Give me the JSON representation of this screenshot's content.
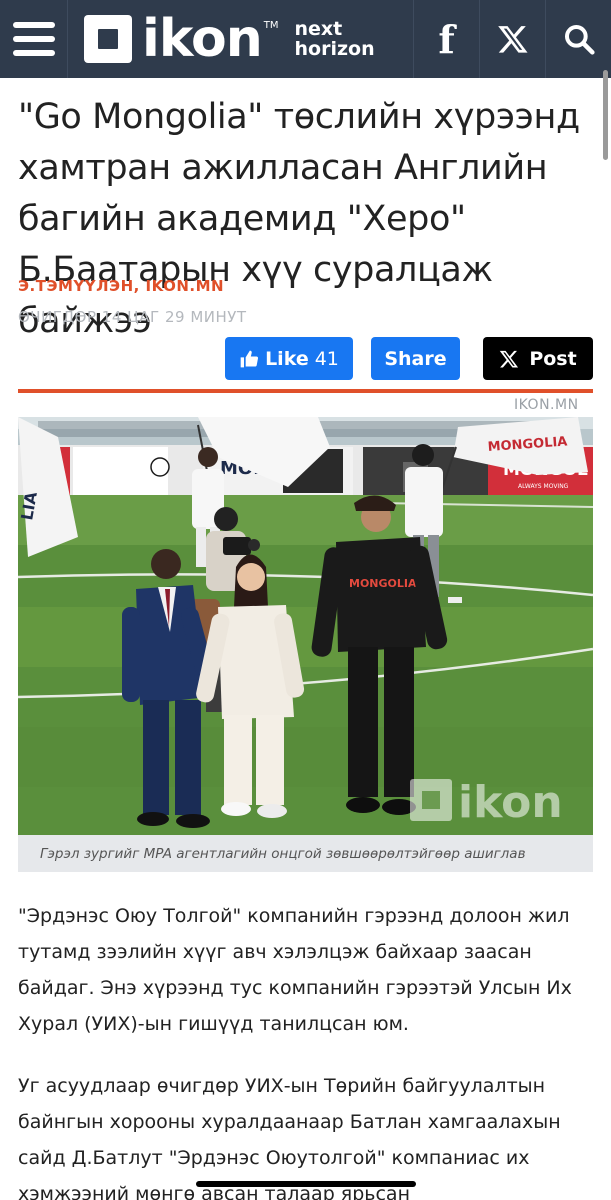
{
  "header": {
    "logo_word": "ikon",
    "logo_tm": "TM",
    "tagline_line1": "next",
    "tagline_line2": "horizon",
    "facebook_glyph": "f"
  },
  "article": {
    "title": "\"Go Mongolia\" төслийн хүрээнд хамтран ажилласан Английн багийн академид \"Херо\" Б.Баатарын хүү суралцаж байжээ",
    "author": "Э.ТЭМҮҮЛЭН, IKON.MN",
    "time": "ӨЧИГДӨР 14 ЦАГ 29 МИНУТ",
    "source": "IKON.MN",
    "caption": "Гэрэл зургийг MPA агентлагийн онцгой зөвшөөрөлтэйгөөр ашиглав",
    "paragraphs": [
      "\"Эрдэнэс Оюу Толгой\" компанийн гэрээнд долоон жил тутамд зээлийн хүүг авч хэлэлцэж байхаар заасан байдаг. Энэ хүрээнд тус компанийн гэрээтэй Улсын Их Хурал (УИХ)-ын гишүүд танилцсан юм.",
      "Уг асуудлаар өчигдөр УИХ-ын Төрийн байгуулалтын байнгын хорооны хуралдаанаар Батлан хамгаалахын сайд Д.Батлут \"Эрдэнэс Оюутолгой\" компаниас их хэмжээний мөнгө авсан талаар ярьсан"
    ]
  },
  "photo": {
    "board_text_left": "MONGOL",
    "board_text_right": "MONGOL",
    "board_subtext": "ALWAYS MOVING",
    "shirt_text": "MONGOLIA",
    "watermark": "ikon",
    "flag_text_right": "MONGOLIA",
    "flag_text_left": "LIA"
  },
  "social": {
    "like_label": "Like",
    "like_count": "41",
    "share_label": "Share",
    "post_label": "Post"
  },
  "colors": {
    "header_bg": "#2f3b4c",
    "accent": "#e0502a",
    "facebook_blue": "#1877f2"
  },
  "icons": [
    "menu-icon",
    "facebook-icon",
    "x-icon",
    "search-icon",
    "thumbs-up-icon"
  ]
}
